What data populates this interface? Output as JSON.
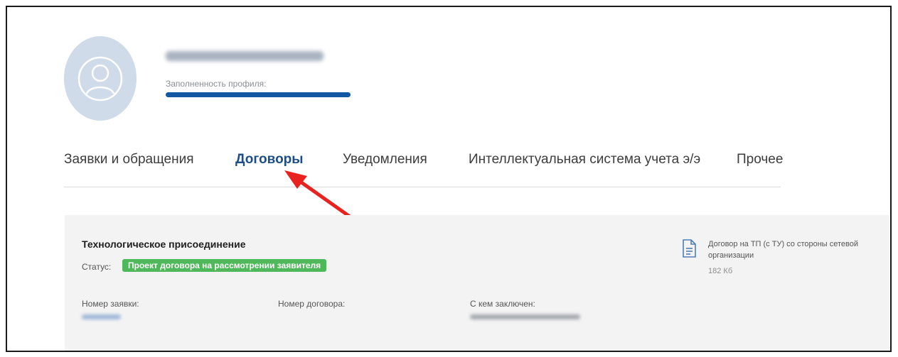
{
  "profile": {
    "completeness_label": "Заполненность профиля:",
    "completeness_value": 100
  },
  "tabs": [
    {
      "label": "Заявки и обращения",
      "active": false
    },
    {
      "label": "Договоры",
      "active": true
    },
    {
      "label": "Уведомления",
      "active": false
    },
    {
      "label": "Интеллектуальная система учета э/э",
      "active": false
    },
    {
      "label": "Прочее",
      "active": false
    }
  ],
  "contract": {
    "title": "Технологическое присоединение",
    "status_label": "Статус:",
    "status_value": "Проект договора на рассмотрении заявителя",
    "fields": {
      "request_number_label": "Номер заявки:",
      "contract_number_label": "Номер договора:",
      "counterparty_label": "С кем заключен:"
    },
    "document": {
      "title": "Договор на ТП (с ТУ) со стороны сетевой организации",
      "size": "182 Кб"
    }
  },
  "colors": {
    "accent": "#1258a3",
    "active_tab": "#1d4f86",
    "status_badge": "#4fb85a",
    "card_background": "#f3f3f3",
    "annotation_arrow": "#e8231f"
  },
  "icons": {
    "avatar": "user-avatar-icon",
    "document": "document-icon",
    "annotation": "red-arrow-icon"
  }
}
